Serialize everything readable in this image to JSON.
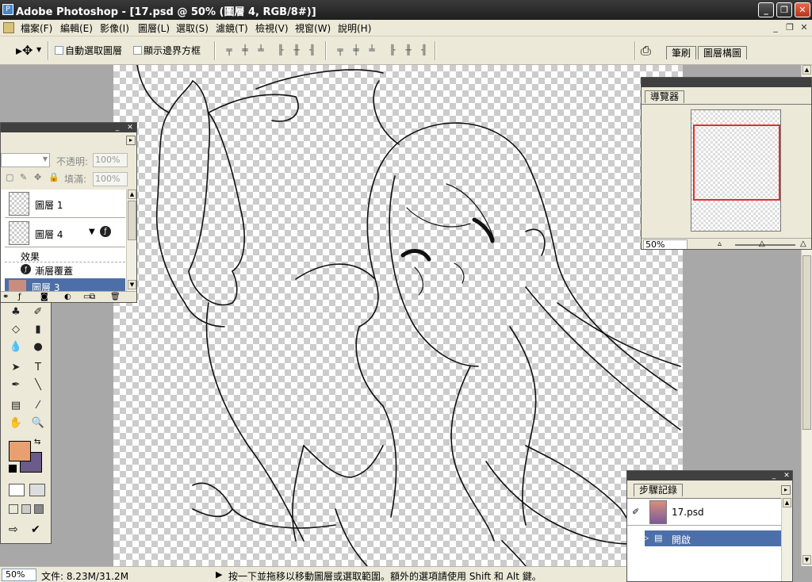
{
  "window": {
    "title": "Adobe Photoshop - [17.psd @ 50% (圖層 4, RGB/8#)]",
    "minimize": "_",
    "restore": "❐",
    "close": "✕"
  },
  "menubar": {
    "items": [
      "檔案(F)",
      "編輯(E)",
      "影像(I)",
      "圖層(L)",
      "選取(S)",
      "濾鏡(T)",
      "檢視(V)",
      "視窗(W)",
      "說明(H)"
    ],
    "doc_minimize": "_",
    "doc_restore": "❐",
    "doc_close": "✕"
  },
  "options_bar": {
    "auto_select_label": "自動選取圖層",
    "show_bounds_label": "顯示邊界方框",
    "well_tabs": [
      "筆刷",
      "圖層構圖"
    ]
  },
  "layers_panel": {
    "opacity_label": "不透明:",
    "opacity_value": "100%",
    "fill_label": "填滿:",
    "fill_value": "100%",
    "layers": [
      {
        "name": "圖層 1"
      },
      {
        "name": "圖層 4"
      }
    ],
    "effects_label": "效果",
    "effect_name": "漸層覆蓋",
    "selected_layer": "圖層 3"
  },
  "navigator": {
    "tab": "導覽器",
    "zoom": "50%"
  },
  "history": {
    "tab": "步驟記錄",
    "snapshot": "17.psd",
    "state": "開啟"
  },
  "toolbox": {
    "foreground_color": "#e8a070",
    "background_color": "#6b5a8a"
  },
  "status": {
    "zoom": "50%",
    "doc_info": "文件: 8.23M/31.2M",
    "hint": "按一下並拖移以移動圖層或選取範圍。額外的選項請使用 Shift 和 Alt 鍵。"
  }
}
